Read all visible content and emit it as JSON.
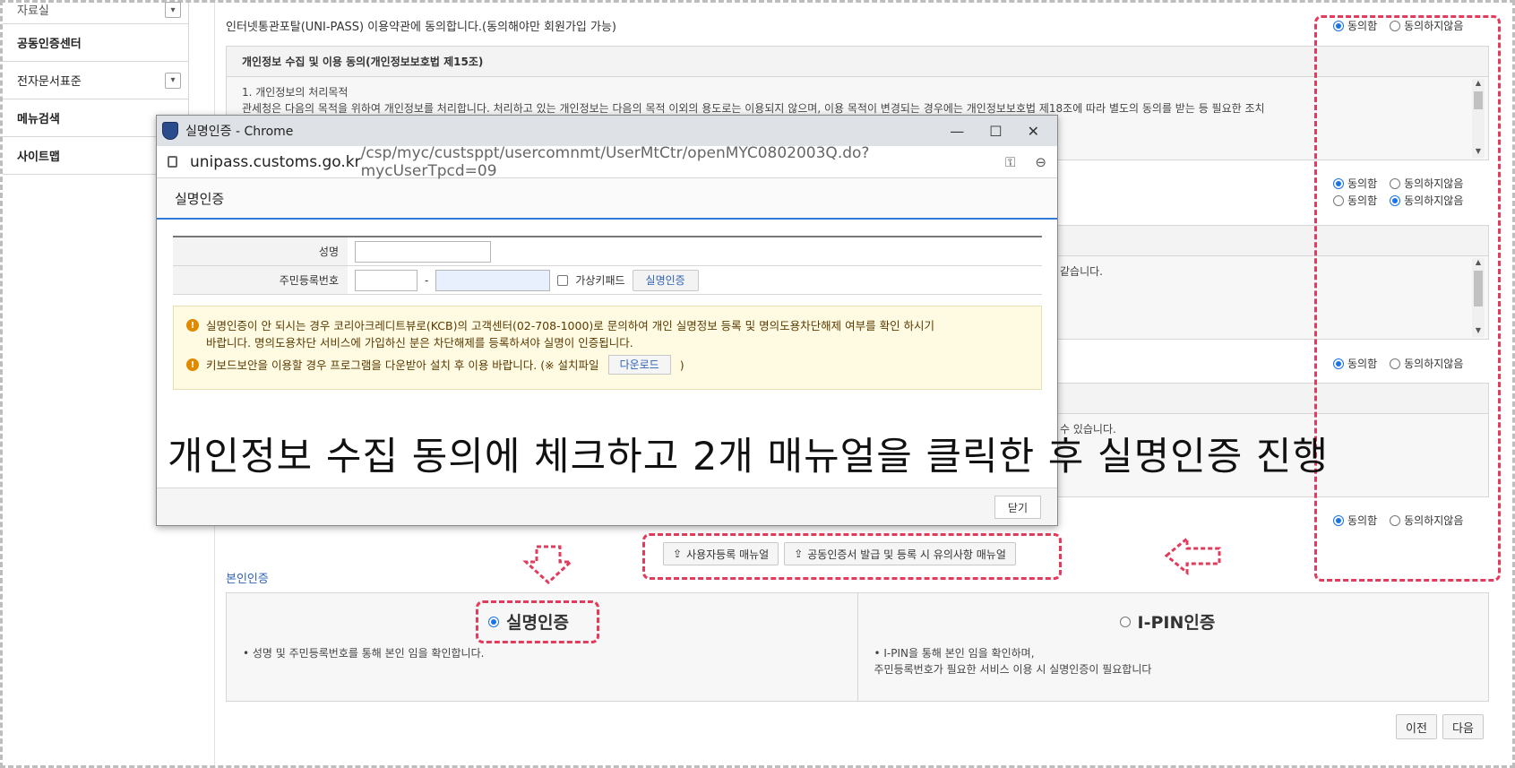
{
  "sidebar": {
    "items": [
      {
        "label": "자료실",
        "chevron": true
      },
      {
        "label": "공동인증센터",
        "chevron": false
      },
      {
        "label": "전자문서표준",
        "chevron": true
      },
      {
        "label": "메뉴검색",
        "chevron": false
      },
      {
        "label": "사이트맵",
        "chevron": false
      }
    ]
  },
  "main": {
    "terms_line": "인터넷통관포탈(UNI-PASS) 이용약관에 동의합니다.(동의해야만 회원가입 가능)",
    "agree_label": "동의함",
    "disagree_label": "동의하지않음",
    "privacy_box": {
      "title": "개인정보 수집 및 이용 동의(개인정보보호법 제15조)",
      "line1": "1. 개인정보의 처리목적",
      "line2": "관세청은 다음의 목적을 위하여 개인정보를 처리합니다. 처리하고 있는 개인정보는 다음의 목적 이외의 용도로는 이용되지 않으며, 이용 목적이 변경되는 경우에는 개인정보보호법 제18조에 따라 별도의 동의를 받는 등 필요한 조치"
    },
    "box2_text": "같습니다.",
    "box3_text": "수 있습니다.",
    "manual_buttons": [
      "사용자등록 매뉴얼",
      "공동인증서 발급 및 등록 시 유의사항 매뉴얼"
    ],
    "auth": {
      "title": "본인인증",
      "realname": {
        "label": "실명인증",
        "desc": "• 성명 및 주민등록번호를 통해 본인 임을 확인합니다."
      },
      "ipin": {
        "label": "I-PIN인증",
        "desc": "• I-PIN을 통해 본인 임을 확인하며,\n  주민등록번호가 필요한 서비스 이용 시 실명인증이 필요합니다"
      }
    },
    "nav": {
      "prev": "이전",
      "next": "다음"
    }
  },
  "popup": {
    "window_title": "실명인증 - Chrome",
    "url_host": "unipass.customs.go.kr",
    "url_path": "/csp/myc/custsppt/usercomnmt/UserMtCtr/openMYC0802003Q.do?mycUserTpcd=09",
    "heading": "실명인증",
    "form": {
      "name_label": "성명",
      "rrn_label": "주민등록번호",
      "dash": "-",
      "keypad_label": "가상키패드",
      "verify_button": "실명인증"
    },
    "notice": {
      "line1": "실명인증이 안 되시는 경우 코리아크레디트뷰로(KCB)의 고객센터(02-708-1000)로 문의하여 개인 실명정보 등록 및 명의도용차단해제 여부를 확인 하시기",
      "line1b": "바랍니다. 명의도용차단 서비스에 가입하신 분은 차단해제를 등록하셔야 실명이 인증됩니다.",
      "line2_pre": "키보드보안을 이용할 경우 프로그램을 다운받아 설치 후 이용 바랍니다. (※ 설치파일",
      "download_button": "다운로드",
      "line2_post": ")"
    },
    "close_button": "닫기"
  },
  "caption": "개인정보 수집 동의에 체크하고 2개 매뉴얼을 클릭한 후 실명인증 진행",
  "colors": {
    "annotation_red": "#e23b5b",
    "accent_blue": "#1a73e8",
    "link_blue": "#2f63b5"
  }
}
